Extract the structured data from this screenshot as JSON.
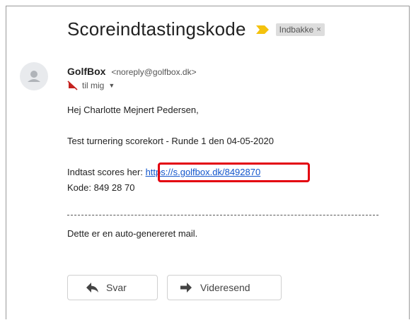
{
  "email": {
    "subject": "Scoreindtastingskode",
    "label": "Indbakke",
    "label_close": "×",
    "sender_name": "GolfBox",
    "sender_email": "<noreply@golfbox.dk>",
    "to_text": "til mig",
    "greeting": "Hej Charlotte Mejnert Pedersen,",
    "tournament_line": "Test turnering scorekort - Runde 1 den 04-05-2020",
    "scores_prefix": "Indtast scores her:",
    "scores_link": "https://s.golfbox.dk/8492870",
    "code_line": "Kode: 849 28 70",
    "footer_text": "Dette er en auto-genereret mail."
  },
  "actions": {
    "reply_label": "Svar",
    "forward_label": "Videresend"
  },
  "colors": {
    "link": "#1155cc",
    "highlight": "#e3000f",
    "important_marker": "#f4c20d"
  }
}
